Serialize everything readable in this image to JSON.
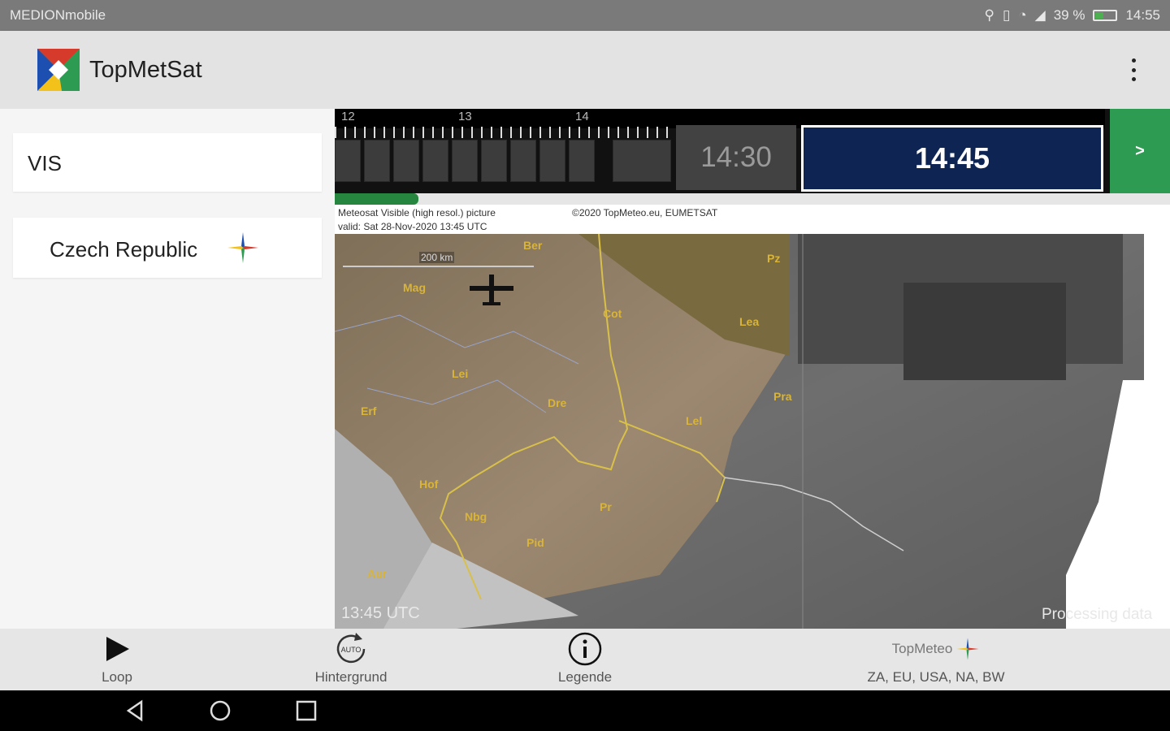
{
  "status_bar": {
    "carrier": "MEDIONmobile",
    "battery": "39 %",
    "time": "14:55"
  },
  "app": {
    "title": "TopMetSat"
  },
  "sidebar": {
    "channel": "VIS",
    "region": "Czech Republic"
  },
  "timeline": {
    "hours": [
      "12",
      "13",
      "14"
    ],
    "prev_time": "14:30",
    "current_time": "14:45",
    "next_label": ">",
    "loading_progress_pct": 10
  },
  "map": {
    "header_line1": "Meteosat Visible (high resol.) picture",
    "header_line2": "valid:  Sat 28-Nov-2020  13:45 UTC",
    "copyright": "©2020 TopMeteo.eu, EUMETSAT",
    "scale": "200 km",
    "utc_label": "13:45 UTC",
    "processing_label": "Processing data",
    "cities": [
      "Ber",
      "Mag",
      "Pz",
      "Cot",
      "Lea",
      "Lei",
      "Dre",
      "Pra",
      "Erf",
      "Lel",
      "Hof",
      "Pr",
      "Nbg",
      "Pid",
      "Aur"
    ]
  },
  "bottom_bar": {
    "loop_label": "Loop",
    "background_label": "Hintergrund",
    "auto_badge": "AUTO",
    "legend_label": "Legende",
    "topmeteo_brand": "TopMeteo",
    "topmeteo_regions": "ZA, EU, USA, NA, BW"
  },
  "colors": {
    "accent_green": "#2e9b52",
    "current_time_bg": "#0e2553",
    "appbar": "#e3e3e3"
  }
}
